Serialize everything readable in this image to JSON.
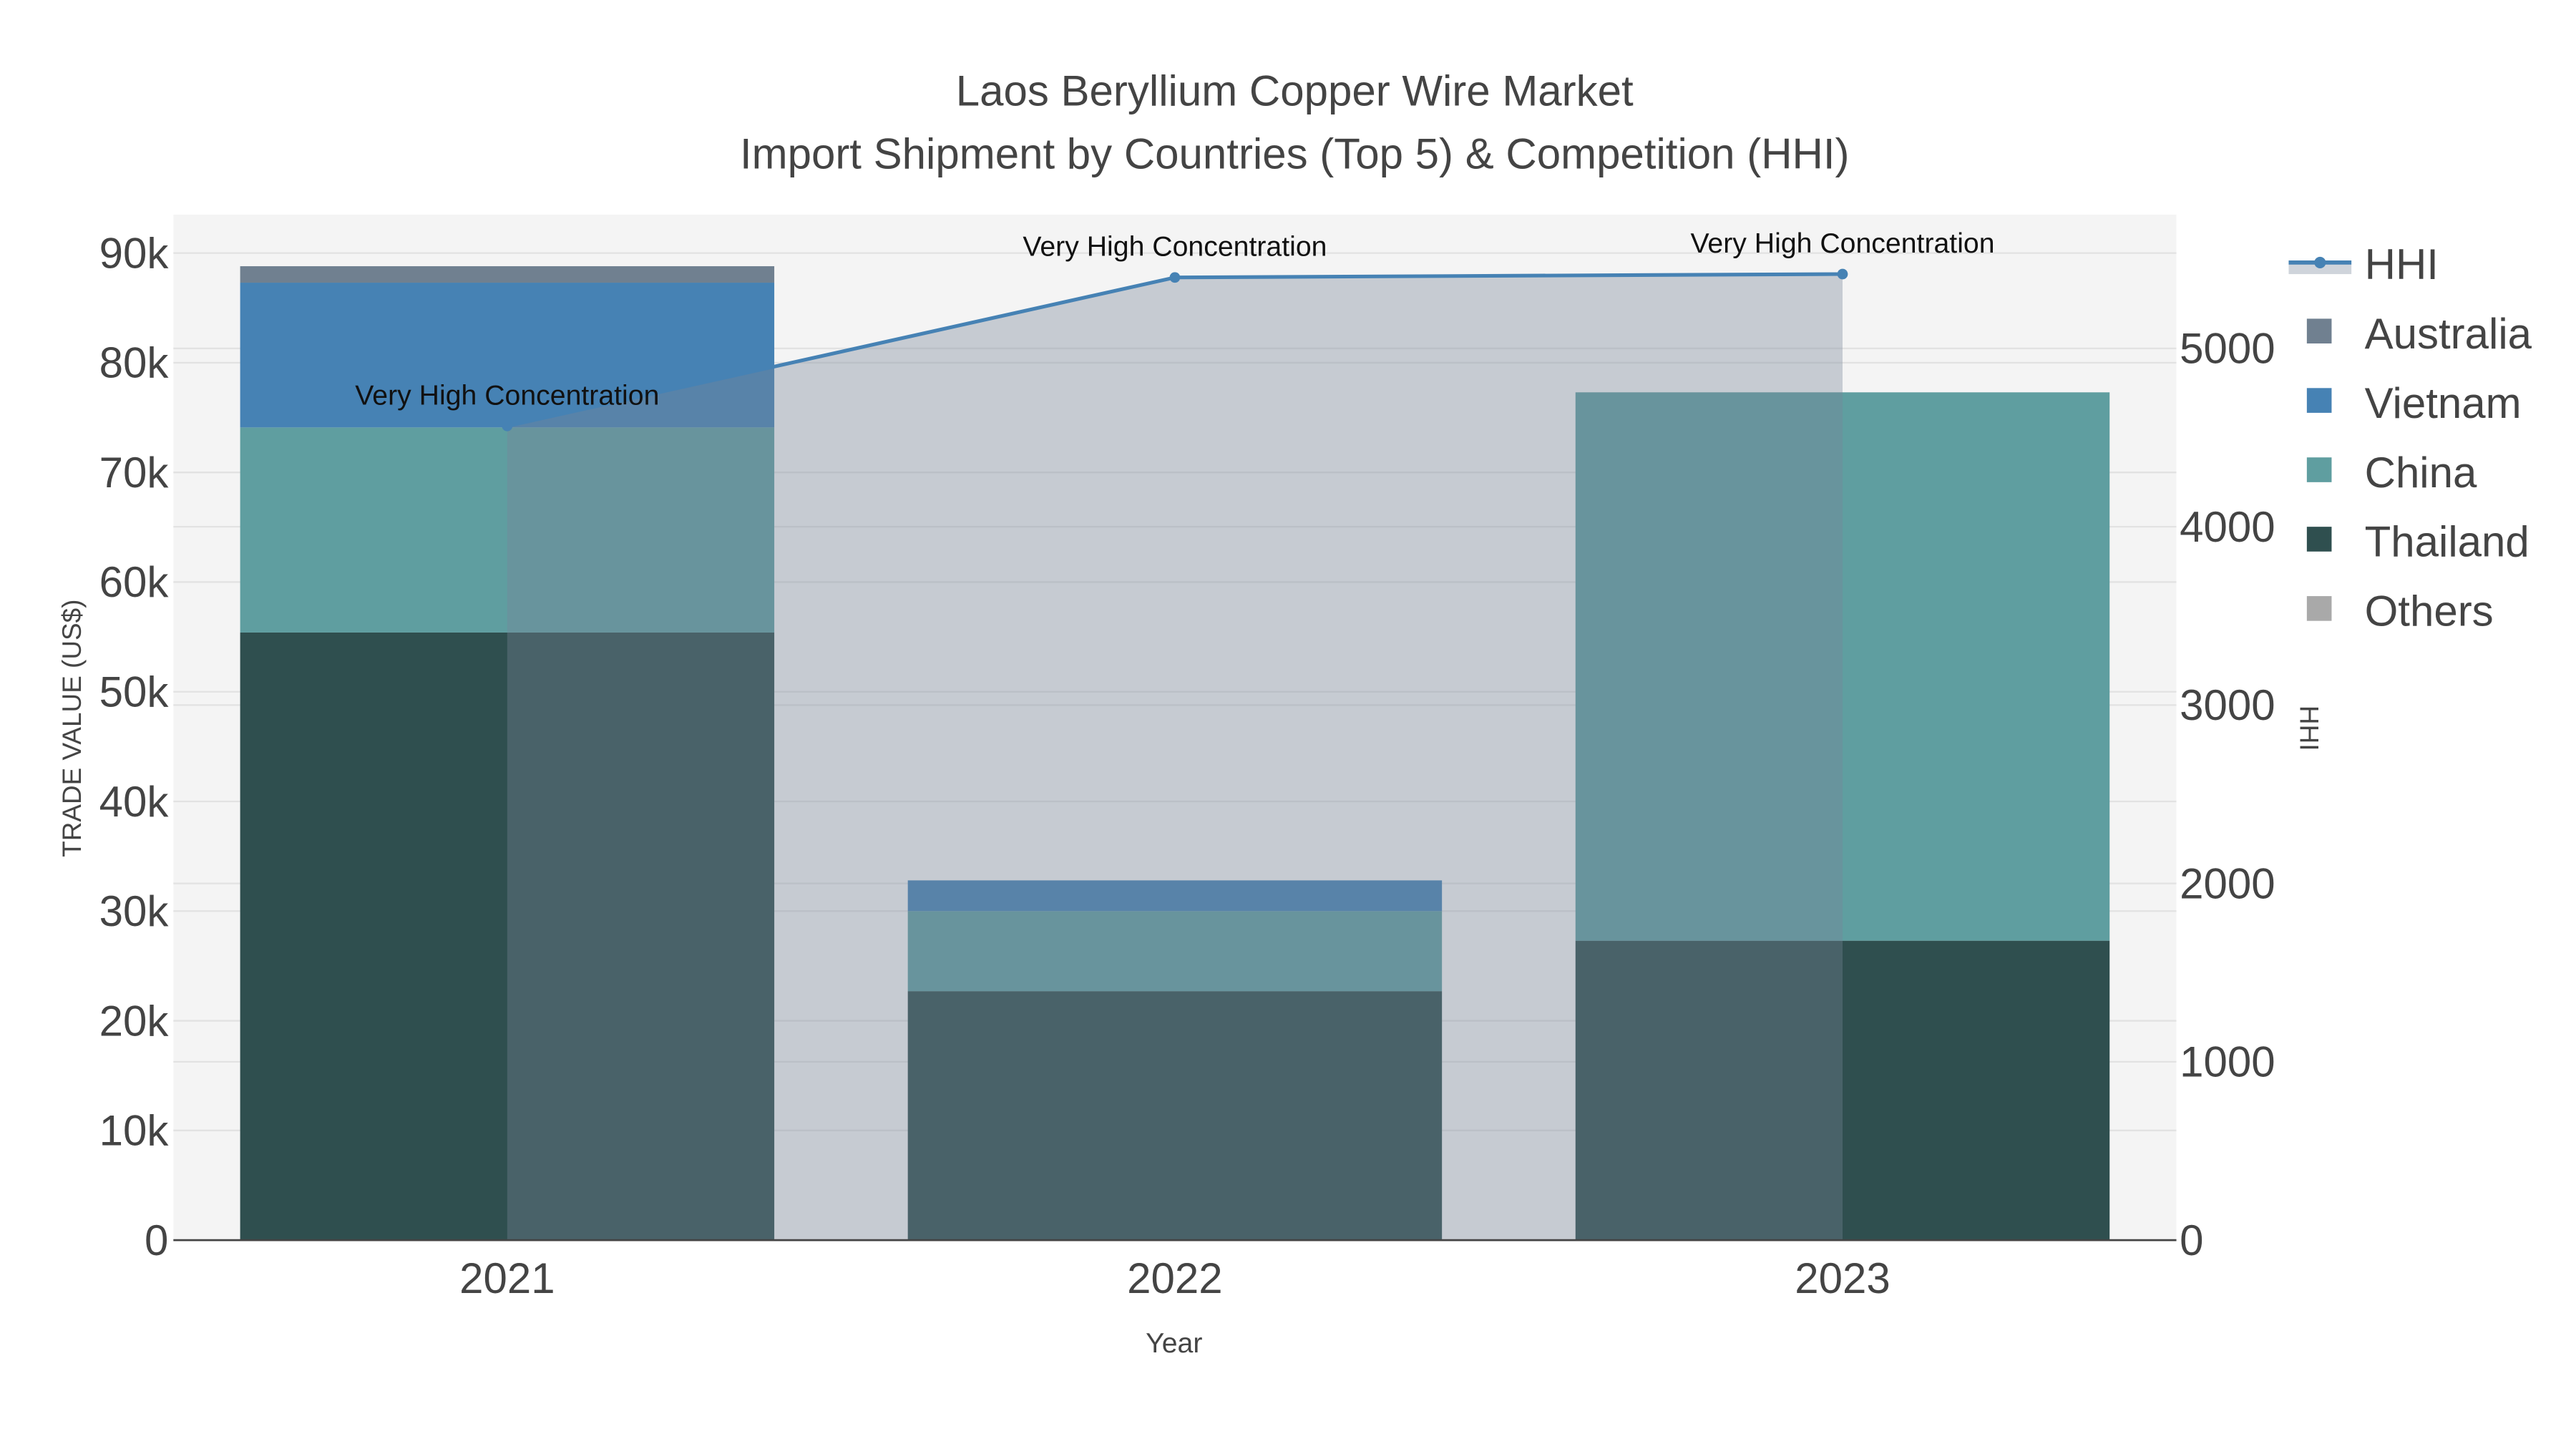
{
  "chart_data": {
    "type": "bar",
    "title": "Laos Beryllium Copper Wire Market",
    "subtitle": "Import Shipment by Countries (Top 5) & Competition (HHI)",
    "xlabel": "Year",
    "ylabel": "TRADE VALUE (US$)",
    "y2label": "HHI",
    "categories": [
      "2021",
      "2022",
      "2023"
    ],
    "ylim": [
      0,
      93500
    ],
    "y2lim": [
      0,
      5750
    ],
    "yticks": [
      0,
      10000,
      20000,
      30000,
      40000,
      50000,
      60000,
      70000,
      80000,
      90000
    ],
    "yticklabels": [
      "0",
      "10k",
      "20k",
      "30k",
      "40k",
      "50k",
      "60k",
      "70k",
      "80k",
      "90k"
    ],
    "y2ticks": [
      0,
      1000,
      2000,
      3000,
      4000,
      5000
    ],
    "y2ticklabels": [
      "0",
      "1000",
      "2000",
      "3000",
      "4000",
      "5000"
    ],
    "grid": true,
    "legend_position": "right",
    "series": [
      {
        "name": "Thailand",
        "color": "#2f4f4f",
        "values": [
          55400,
          22700,
          27300
        ]
      },
      {
        "name": "China",
        "color": "#5f9ea0",
        "values": [
          18700,
          7300,
          50000
        ]
      },
      {
        "name": "Vietnam",
        "color": "#4682b4",
        "values": [
          13200,
          2800,
          0
        ]
      },
      {
        "name": "Australia",
        "color": "#708090",
        "values": [
          1500,
          0,
          0
        ]
      },
      {
        "name": "Others",
        "color": "#a9a9a9",
        "values": [
          0,
          0,
          0
        ]
      }
    ],
    "hhi": {
      "name": "HHI",
      "color": "#4682b4",
      "values": [
        4565,
        5398,
        5417
      ],
      "annotations": [
        "Very High Concentration",
        "Very High Concentration",
        "Very High Concentration"
      ]
    },
    "legend": [
      "HHI",
      "Australia",
      "Vietnam",
      "China",
      "Thailand",
      "Others"
    ]
  }
}
